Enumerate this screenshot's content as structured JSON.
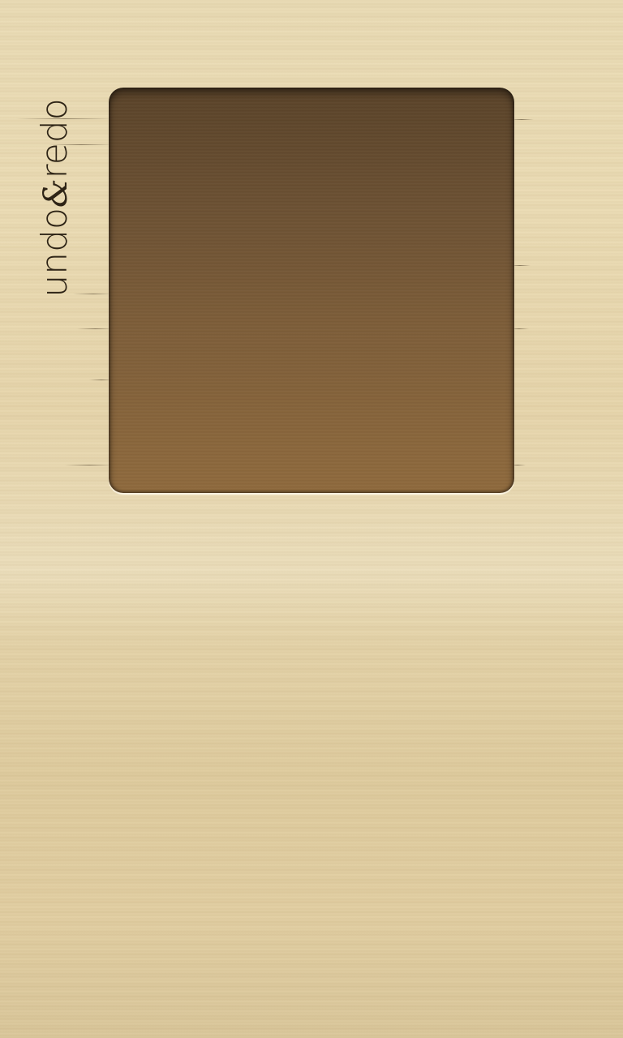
{
  "app": {
    "logo": {
      "left_text": "undo",
      "ampersand": "&",
      "right_text": "redo"
    }
  },
  "colors": {
    "wood_background": "#e7d6ad",
    "board_top": "#5a4329",
    "board_bottom": "#8f6a3d",
    "logo_text": "#2e2416"
  },
  "board": {
    "state": "empty"
  }
}
